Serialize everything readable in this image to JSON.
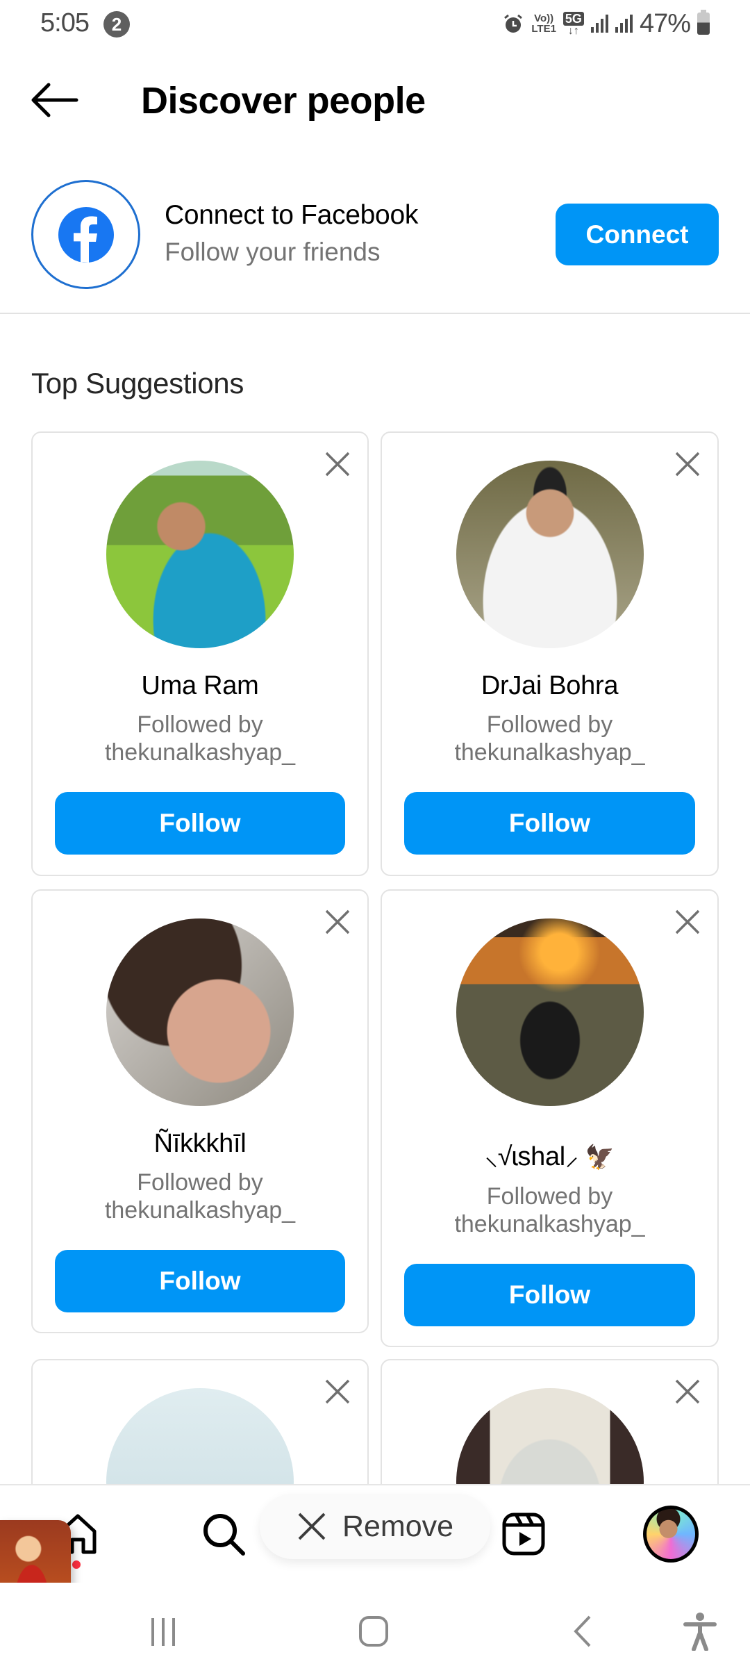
{
  "status_bar": {
    "time": "5:05",
    "notification_count": "2",
    "volte": "Vo))",
    "lte": "LTE1",
    "network": "5G",
    "battery_percent": "47%"
  },
  "header": {
    "title": "Discover people",
    "back_icon": "arrow-left-icon"
  },
  "facebook": {
    "title": "Connect to Facebook",
    "subtitle": "Follow your friends",
    "connect_label": "Connect",
    "brand_color": "#1877f2"
  },
  "section_title": "Top Suggestions",
  "suggestions": [
    {
      "name": "Uma Ram",
      "followed_by_label": "Followed by",
      "followed_by": "thekunalkashyap_",
      "follow_label": "Follow"
    },
    {
      "name": "DrJai Bohra",
      "followed_by_label": "Followed by",
      "followed_by": "thekunalkashyap_",
      "follow_label": "Follow"
    },
    {
      "name": "Ñīkkkhīl",
      "followed_by_label": "Followed by",
      "followed_by": "thekunalkashyap_",
      "follow_label": "Follow"
    },
    {
      "name": "⸜√ɩshal⸝",
      "name_emoji": "🦅",
      "followed_by_label": "Followed by",
      "followed_by": "thekunalkashyap_",
      "follow_label": "Follow"
    },
    {
      "name": "",
      "followed_by_label": "",
      "followed_by": "",
      "follow_label": ""
    },
    {
      "name": "",
      "followed_by_label": "",
      "followed_by": "",
      "follow_label": ""
    }
  ],
  "toast": {
    "remove_label": "Remove"
  },
  "bottom_nav": {
    "items": [
      "home",
      "search",
      "reels",
      "profile"
    ]
  },
  "colors": {
    "primary_button": "#0095f6",
    "secondary_text": "#737373",
    "card_border": "#e3e3e3"
  }
}
